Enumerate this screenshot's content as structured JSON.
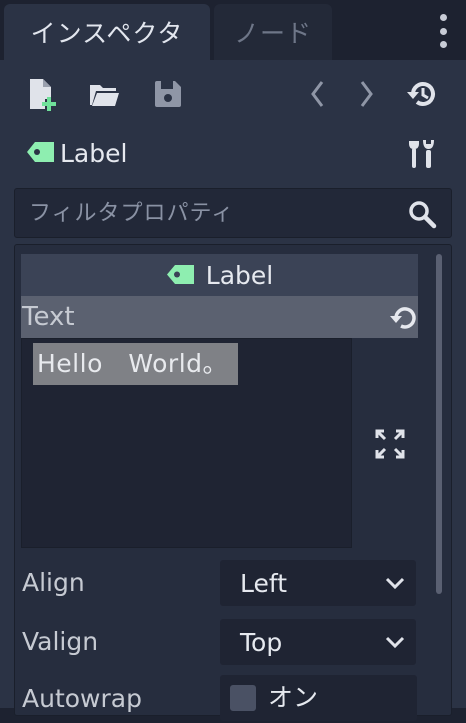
{
  "tabs": {
    "inspector": "インスペクタ",
    "node": "ノード"
  },
  "toolbar": {
    "icons": [
      "new-script-icon",
      "open-folder-icon",
      "save-icon",
      "history-back-icon",
      "history-forward-icon",
      "object-history-icon"
    ]
  },
  "selected_node": {
    "name": "Label",
    "icon": "label-node-icon",
    "accent": "#8eeeb0"
  },
  "filter": {
    "placeholder": "フィルタプロパティ",
    "value": ""
  },
  "section": {
    "title": "Label"
  },
  "text_property": {
    "name": "Text",
    "value": "Hello　World。"
  },
  "properties": [
    {
      "name": "Align",
      "value": "Left"
    },
    {
      "name": "Valign",
      "value": "Top"
    },
    {
      "name": "Autowrap",
      "value": "オン"
    }
  ]
}
